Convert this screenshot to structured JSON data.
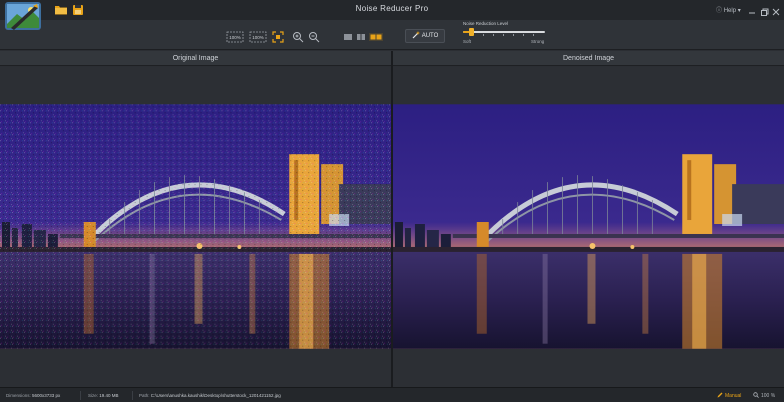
{
  "window": {
    "title": "Noise Reducer Pro",
    "help_label": "Help"
  },
  "toolbar": {
    "fit_label_1": "100%",
    "fit_label_2": "100%",
    "auto_label": "AUTO",
    "noise_reduction": {
      "label": "Noise Reduction Level",
      "min_label": "Soft",
      "max_label": "Strong",
      "level": 0.1
    }
  },
  "panes": {
    "left_title": "Original Image",
    "right_title": "Denoised Image"
  },
  "statusbar": {
    "dimensions_label": "Dimensions:",
    "dimensions_value": "5600x3733 px",
    "size_label": "Size:",
    "size_value": "19.40 MB",
    "path_label": "Path:",
    "path_value": "C:\\Users\\anushka.kaushik\\Desktop\\shutterstock_1201421152.jpg",
    "mode_label": "Manual",
    "zoom_value": "100 %"
  },
  "colors": {
    "accent": "#e8a318",
    "background": "#2b2e33",
    "titlebar": "#24272b"
  },
  "icons": [
    "app-logo-icon",
    "open-folder-icon",
    "save-icon",
    "fit-icon",
    "zoom-in-icon",
    "zoom-out-icon",
    "single-view-icon",
    "split-view-icon",
    "side-by-side-icon",
    "wand-icon",
    "help-icon",
    "minimize-icon",
    "restore-icon",
    "close-icon",
    "pencil-icon",
    "search-icon"
  ]
}
